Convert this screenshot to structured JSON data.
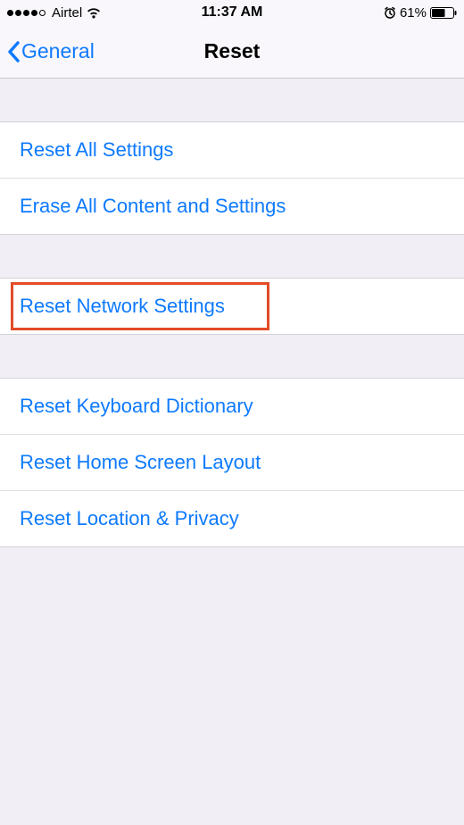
{
  "status_bar": {
    "carrier": "Airtel",
    "time": "11:37 AM",
    "battery_pct": "61%"
  },
  "nav": {
    "back_label": "General",
    "title": "Reset"
  },
  "groups": {
    "g1": {
      "reset_all": "Reset All Settings",
      "erase_all": "Erase All Content and Settings"
    },
    "g2": {
      "reset_network": "Reset Network Settings"
    },
    "g3": {
      "reset_keyboard": "Reset Keyboard Dictionary",
      "reset_home": "Reset Home Screen Layout",
      "reset_location": "Reset Location & Privacy"
    }
  }
}
